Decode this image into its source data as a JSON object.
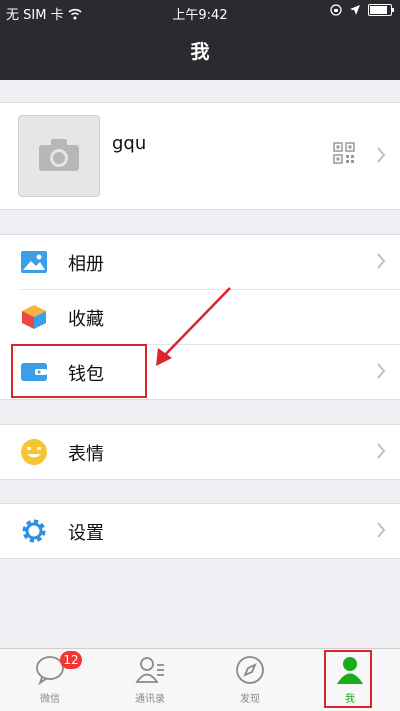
{
  "statusbar": {
    "carrier": "无 SIM 卡",
    "time": "上午9:42"
  },
  "navbar": {
    "title": "我"
  },
  "profile": {
    "name": "gqu"
  },
  "menu": {
    "album": "相册",
    "favorites": "收藏",
    "wallet": "钱包",
    "stickers": "表情",
    "settings": "设置"
  },
  "tabbar": {
    "tabs": [
      {
        "label": "微信",
        "badge": "12"
      },
      {
        "label": "通讯录"
      },
      {
        "label": "发现"
      },
      {
        "label": "我"
      }
    ]
  },
  "colors": {
    "accent": "#1aad19",
    "highlight": "#d9252b",
    "badge": "#f43530"
  }
}
